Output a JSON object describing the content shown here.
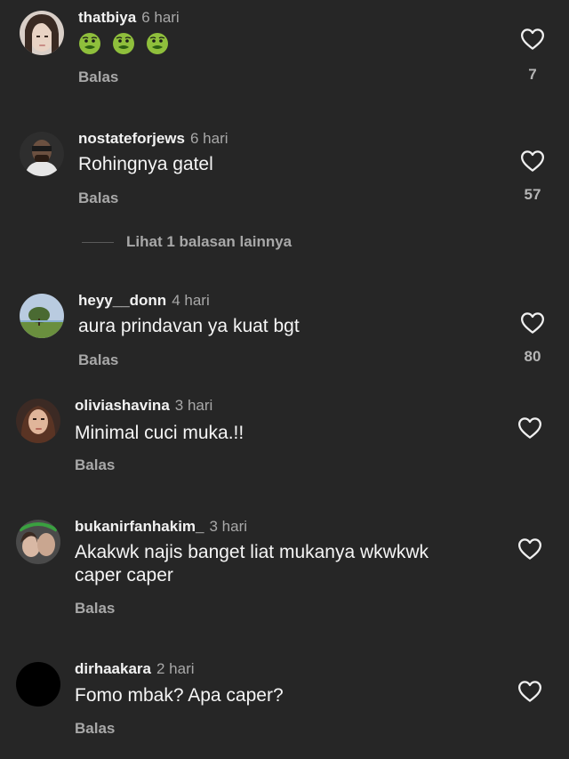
{
  "reply_label": "Balas",
  "comments": [
    {
      "username": "thatbiya",
      "time": "6 hari",
      "text": "",
      "emojis": [
        "nauseated-face",
        "nauseated-face",
        "nauseated-face"
      ],
      "likes": "7"
    },
    {
      "username": "nostateforjews",
      "time": "6 hari",
      "text": "Rohingnya gatel",
      "likes": "57"
    },
    {
      "username": "heyy__donn",
      "time": "4 hari",
      "text": "aura prindavan ya kuat bgt",
      "likes": "80"
    },
    {
      "username": "oliviashavina",
      "time": "3 hari",
      "text": "Minimal cuci muka.!!",
      "likes": ""
    },
    {
      "username": "bukanirfanhakim_",
      "time": "3 hari",
      "text_lines": [
        "Akakwk najis banget liat mukanya wkwkwk",
        "caper caper"
      ],
      "likes": ""
    },
    {
      "username": "dirhaakara",
      "time": "2 hari",
      "text": "Fomo mbak? Apa caper?",
      "likes": ""
    }
  ],
  "view_more_replies": "Lihat 1 balasan lainnya",
  "icons": {
    "heart": "heart-outline-icon",
    "emoji": "nauseated-face-emoji"
  },
  "colors": {
    "background": "#262626",
    "text": "#f5f5f5",
    "secondary": "#a8a8a8"
  }
}
